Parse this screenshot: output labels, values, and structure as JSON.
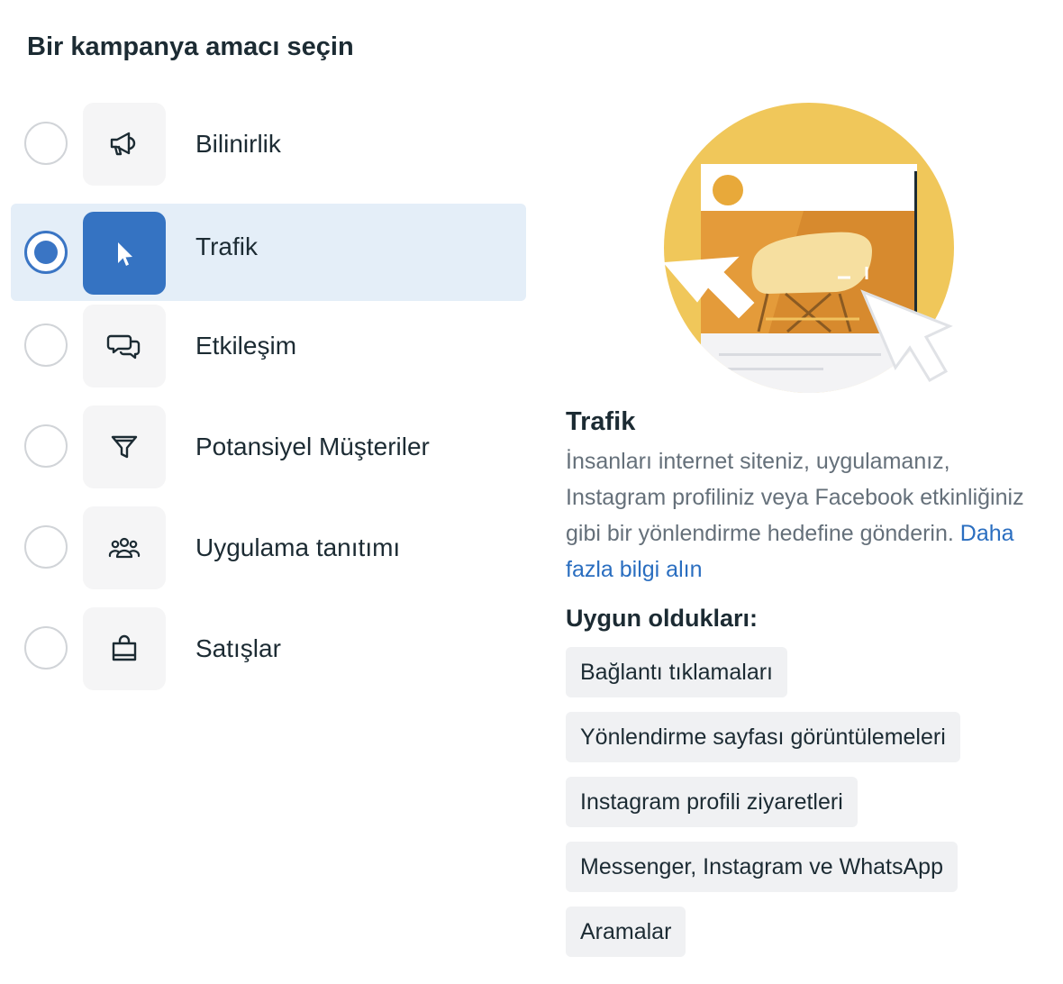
{
  "page": {
    "title": "Bir kampanya amacı seçin"
  },
  "objectives": [
    {
      "label": "Bilinirlik",
      "icon": "megaphone-icon",
      "selected": false
    },
    {
      "label": "Trafik",
      "icon": "cursor-icon",
      "selected": true
    },
    {
      "label": "Etkileşim",
      "icon": "chat-bubbles-icon",
      "selected": false
    },
    {
      "label": "Potansiyel Müşteriler",
      "icon": "funnel-icon",
      "selected": false
    },
    {
      "label": "Uygulama tanıtımı",
      "icon": "people-group-icon",
      "selected": false
    },
    {
      "label": "Satışlar",
      "icon": "shopping-bag-icon",
      "selected": false
    }
  ],
  "detail": {
    "title": "Trafik",
    "description": "İnsanları internet siteniz, uygulamanız, Instagram profiliniz veya Facebook etkinliğiniz gibi bir yönlendirme hedefine gönderin.",
    "learn_more": "Daha fazla bilgi alın",
    "good_for_label": "Uygun oldukları:",
    "chips": [
      "Bağlantı tıklamaları",
      "Yönlendirme sayfası görüntülemeleri",
      "Instagram profili ziyaretleri",
      "Messenger, Instagram ve WhatsApp",
      "Aramalar"
    ]
  },
  "colors": {
    "accent": "#3573c2",
    "selected_bg": "#e4eef8",
    "link": "#2a6ec0",
    "illustration_circle": "#f0c75a"
  }
}
